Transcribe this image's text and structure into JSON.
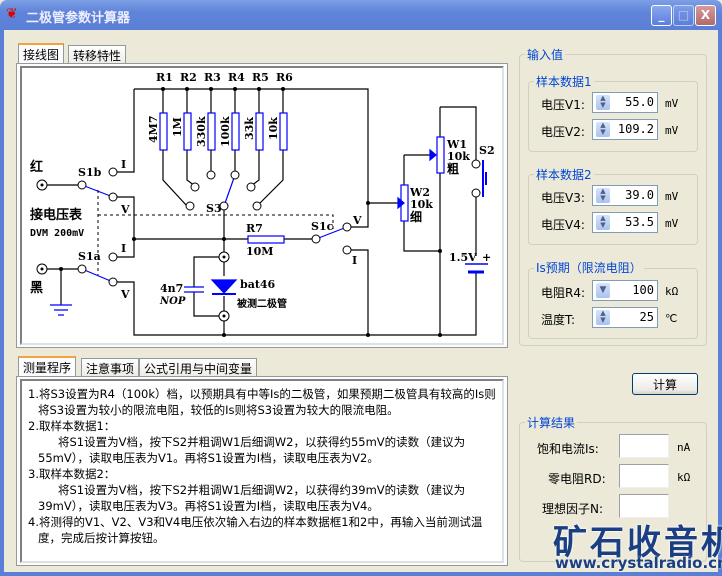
{
  "window": {
    "title": "二极管参数计算器",
    "minimize": "_",
    "maximize": "□",
    "close": "X"
  },
  "circuit_tabs": [
    {
      "label": "接线图",
      "active": true
    },
    {
      "label": "转移特性",
      "active": false
    }
  ],
  "circuit": {
    "resistors": [
      {
        "name": "R1",
        "value": "4M7"
      },
      {
        "name": "R2",
        "value": "1M"
      },
      {
        "name": "R3",
        "value": "330k"
      },
      {
        "name": "R4",
        "value": "100k"
      },
      {
        "name": "R5",
        "value": "33k"
      },
      {
        "name": "R6",
        "value": "10k"
      }
    ],
    "red": "红",
    "black": "黑",
    "meter": "接电压表",
    "meter_model": "DVM 200mV",
    "s1b": "S1b",
    "s1a": "S1a",
    "s1c": "S1c",
    "s3": "S3",
    "s2": "S2",
    "i": "I",
    "v": "V",
    "r7": "R7",
    "r7_value": "10M",
    "cap": "4n7",
    "cap_note": "NOP",
    "diode": "bat46",
    "diode_label": "被测二极管",
    "w1": "W1",
    "w1_value": "10k",
    "w1_note": "粗",
    "w2": "W2",
    "w2_value": "10k",
    "w2_note": "细",
    "battery": "1.5V",
    "plus": "+"
  },
  "info_tabs": [
    {
      "label": "测量程序",
      "active": true
    },
    {
      "label": "注意事项",
      "active": false
    },
    {
      "label": "公式引用与中间变量",
      "active": false
    }
  ],
  "procedure": [
    {
      "text": "1.将S3设置为R4（100k）档，以预期具有中等Is的二极管，如果预期二极管具有较高的Is则将S3设置为较小的限流电阻，较低的Is则将S3设置为较大的限流电阻。",
      "sub": false
    },
    {
      "text": "2.取样本数据1：",
      "sub": false
    },
    {
      "text": "将S1设置为V档，按下S2并粗调W1后细调W2，以获得约55mV的读数（建议为55mV），读取电压表为V1。再将S1设置为I档，读取电压表为V2。",
      "sub": true
    },
    {
      "text": "3.取样本数据2：",
      "sub": false
    },
    {
      "text": "将S1设置为V档，按下S2并粗调W1后细调W2，以获得约39mV的读数（建议为39mV），读取电压表为V3。再将S1设置为I档，读取电压表为V4。",
      "sub": true
    },
    {
      "text": "4.将测得的V1、V2、V3和V4电压依次输入右边的样本数据框1和2中，再输入当前测试温度，完成后按计算按钮。",
      "sub": false
    }
  ],
  "inputs": {
    "title": "输入值",
    "groups": [
      {
        "title": "样本数据1",
        "fields": [
          {
            "label": "电压V1:",
            "value": "55.0",
            "unit": "mV",
            "spinner": "up-down"
          },
          {
            "label": "电压V2:",
            "value": "109.2",
            "unit": "mV",
            "spinner": "up-down"
          }
        ]
      },
      {
        "title": "样本数据2",
        "fields": [
          {
            "label": "电压V3:",
            "value": "39.0",
            "unit": "mV",
            "spinner": "up-down"
          },
          {
            "label": "电压V4:",
            "value": "53.5",
            "unit": "mV",
            "spinner": "up-down"
          }
        ]
      },
      {
        "title": "Is预期（限流电阻）",
        "fields": [
          {
            "label": "电阻R4:",
            "value": "100",
            "unit": "kΩ",
            "spinner": "dropdown"
          },
          {
            "label": "温度T:",
            "value": "25",
            "unit": "℃",
            "spinner": "up-down"
          }
        ]
      }
    ]
  },
  "calc_button": "计算",
  "results": {
    "title": "计算结果",
    "fields": [
      {
        "label": "饱和电流Is:",
        "value": "",
        "unit": "nA"
      },
      {
        "label": "零电阻RD:",
        "value": "",
        "unit": "kΩ"
      },
      {
        "label": "理想因子N:",
        "value": "",
        "unit": ""
      }
    ]
  },
  "watermark": {
    "cn": "矿石收音机",
    "url": "www.crystalradio.cn"
  },
  "colors": {
    "titlebar": "#5a7fd6",
    "group_title": "#0046d5",
    "circuit_blue": "#0000ff",
    "face": "#ece9d8"
  }
}
